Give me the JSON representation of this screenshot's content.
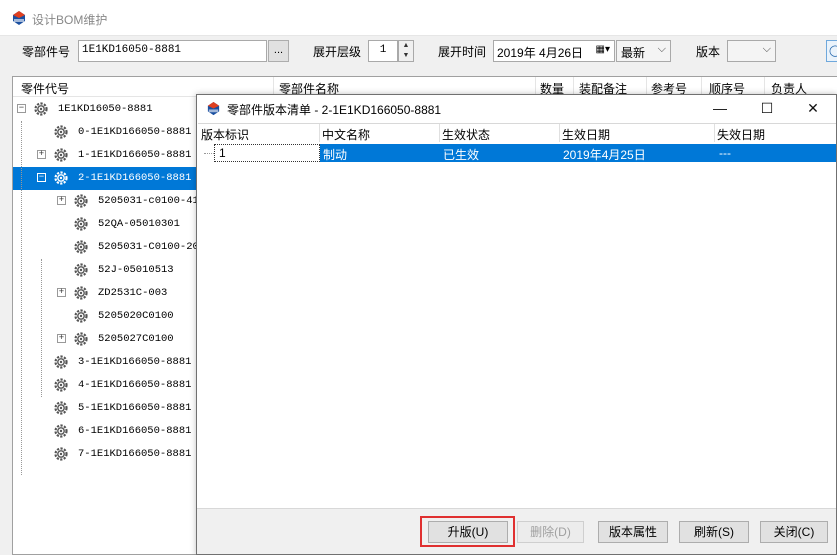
{
  "app": {
    "title": "设计BOM维护"
  },
  "toolbar": {
    "part_no_label": "零部件号",
    "part_no_value": "1E1KD16050-8881",
    "browse_label": "...",
    "level_label": "展开层级",
    "level_value": "1",
    "time_label": "展开时间",
    "time_value": "2019年 4月26日",
    "latest_value": "最新",
    "version_label": "版本",
    "version_value": ""
  },
  "tree": {
    "headers": [
      "零件代号",
      "零部件名称",
      "数量",
      "装配备注",
      "参考号",
      "顺序号",
      "负责人"
    ],
    "rows": [
      {
        "label": "1E1KD16050-8881",
        "level": 0,
        "expander": "−",
        "selected": false
      },
      {
        "label": "0-1E1KD166050-8881",
        "level": 1,
        "expander": "",
        "selected": false
      },
      {
        "label": "1-1E1KD166050-8881",
        "level": 1,
        "expander": "+",
        "selected": false
      },
      {
        "label": "2-1E1KD166050-8881",
        "level": 1,
        "expander": "−",
        "selected": true
      },
      {
        "label": "5205031-c0100-41(",
        "level": 2,
        "expander": "+",
        "selected": false
      },
      {
        "label": "52QA-05010301",
        "level": 2,
        "expander": "",
        "selected": false
      },
      {
        "label": "5205031-C0100-20",
        "level": 2,
        "expander": "",
        "selected": false
      },
      {
        "label": "52J-05010513",
        "level": 2,
        "expander": "",
        "selected": false
      },
      {
        "label": "ZD2531C-003",
        "level": 2,
        "expander": "+",
        "selected": false
      },
      {
        "label": "5205020C0100",
        "level": 2,
        "expander": "",
        "selected": false
      },
      {
        "label": "5205027C0100",
        "level": 2,
        "expander": "+",
        "selected": false
      },
      {
        "label": "3-1E1KD166050-8881",
        "level": 1,
        "expander": "",
        "selected": false
      },
      {
        "label": "4-1E1KD166050-8881",
        "level": 1,
        "expander": "",
        "selected": false
      },
      {
        "label": "5-1E1KD166050-8881",
        "level": 1,
        "expander": "",
        "selected": false
      },
      {
        "label": "6-1E1KD166050-8881",
        "level": 1,
        "expander": "",
        "selected": false
      },
      {
        "label": "7-1E1KD166050-8881",
        "level": 1,
        "expander": "",
        "selected": false
      }
    ]
  },
  "dialog": {
    "title": "零部件版本清单 - 2-1E1KD166050-8881",
    "minimize": "—",
    "maximize": "☐",
    "close": "✕",
    "columns": [
      "版本标识",
      "中文名称",
      "生效状态",
      "生效日期",
      "失效日期"
    ],
    "rows": [
      {
        "version": "1",
        "name": "制动",
        "status": "已生效",
        "effective": "2019年4月25日",
        "expire": "---"
      }
    ],
    "buttons": {
      "upgrade": "升版(U)",
      "delete": "删除(D)",
      "properties": "版本属性",
      "refresh": "刷新(S)",
      "close": "关闭(C)"
    }
  },
  "colors": {
    "selection": "#0078d7",
    "highlight": "#e03030"
  }
}
